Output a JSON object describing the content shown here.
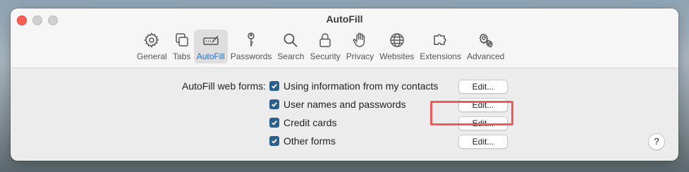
{
  "window": {
    "title": "AutoFill"
  },
  "toolbar": {
    "items": [
      {
        "label": "General",
        "icon": "gear-icon"
      },
      {
        "label": "Tabs",
        "icon": "tabs-icon"
      },
      {
        "label": "AutoFill",
        "icon": "autofill-icon",
        "selected": true
      },
      {
        "label": "Passwords",
        "icon": "key-icon"
      },
      {
        "label": "Search",
        "icon": "search-icon"
      },
      {
        "label": "Security",
        "icon": "lock-icon"
      },
      {
        "label": "Privacy",
        "icon": "hand-icon"
      },
      {
        "label": "Websites",
        "icon": "globe-icon"
      },
      {
        "label": "Extensions",
        "icon": "puzzle-icon"
      },
      {
        "label": "Advanced",
        "icon": "gears-icon"
      }
    ]
  },
  "autofill": {
    "label": "AutoFill web forms:",
    "options": [
      {
        "label": "Using information from my contacts",
        "checked": true,
        "edit": "Edit..."
      },
      {
        "label": "User names and passwords",
        "checked": true,
        "edit": "Edit..."
      },
      {
        "label": "Credit cards",
        "checked": true,
        "edit": "Edit...",
        "highlighted": true
      },
      {
        "label": "Other forms",
        "checked": true,
        "edit": "Edit..."
      }
    ]
  },
  "help": {
    "label": "?"
  },
  "colors": {
    "accent": "#1f6fd1",
    "checkbox": "#2a5f8f",
    "highlight": "#f0595a"
  }
}
